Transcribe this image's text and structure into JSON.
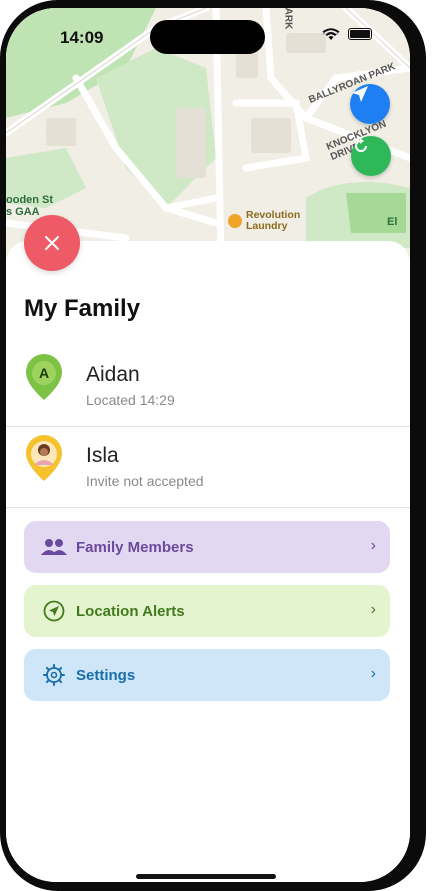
{
  "status_bar": {
    "time": "14:09",
    "signal_dots": "••••"
  },
  "map": {
    "labels": {
      "park_top": "PARK",
      "ballyroan": "BALLYROAN PARK",
      "knocklyon": "KNOCKLYON DRIVE",
      "wooden_st": "ooden St",
      "gaa": "s GAA",
      "poi": "Revolution Laundry",
      "poi_line1": "Revolution",
      "poi_line2": "Laundry",
      "right_edge": "El"
    },
    "colors": {
      "park": "#cfe8c6",
      "road": "#ffffff",
      "water_green": "#a6d896"
    }
  },
  "sheet": {
    "title": "My Family",
    "members": [
      {
        "name": "Aidan",
        "status": "Located 14:29",
        "initial": "A",
        "pin_color": "#7cc244"
      },
      {
        "name": "Isla",
        "status": "Invite not accepted",
        "pin_color": "#f5c22d"
      }
    ],
    "actions": [
      {
        "label": "Family Members",
        "icon": "people-icon",
        "bg": "#e3d8f1",
        "fg": "#6a4a9c"
      },
      {
        "label": "Location Alerts",
        "icon": "navigation-icon",
        "bg": "#e3f4cf",
        "fg": "#447a1e"
      },
      {
        "label": "Settings",
        "icon": "gear-icon",
        "bg": "#cfe6f8",
        "fg": "#1a6fa8"
      }
    ],
    "chevron": "›"
  },
  "colors": {
    "close_button": "#ee5b66",
    "locate_button": "#1e7ff2",
    "refresh_button": "#2fb85a"
  }
}
